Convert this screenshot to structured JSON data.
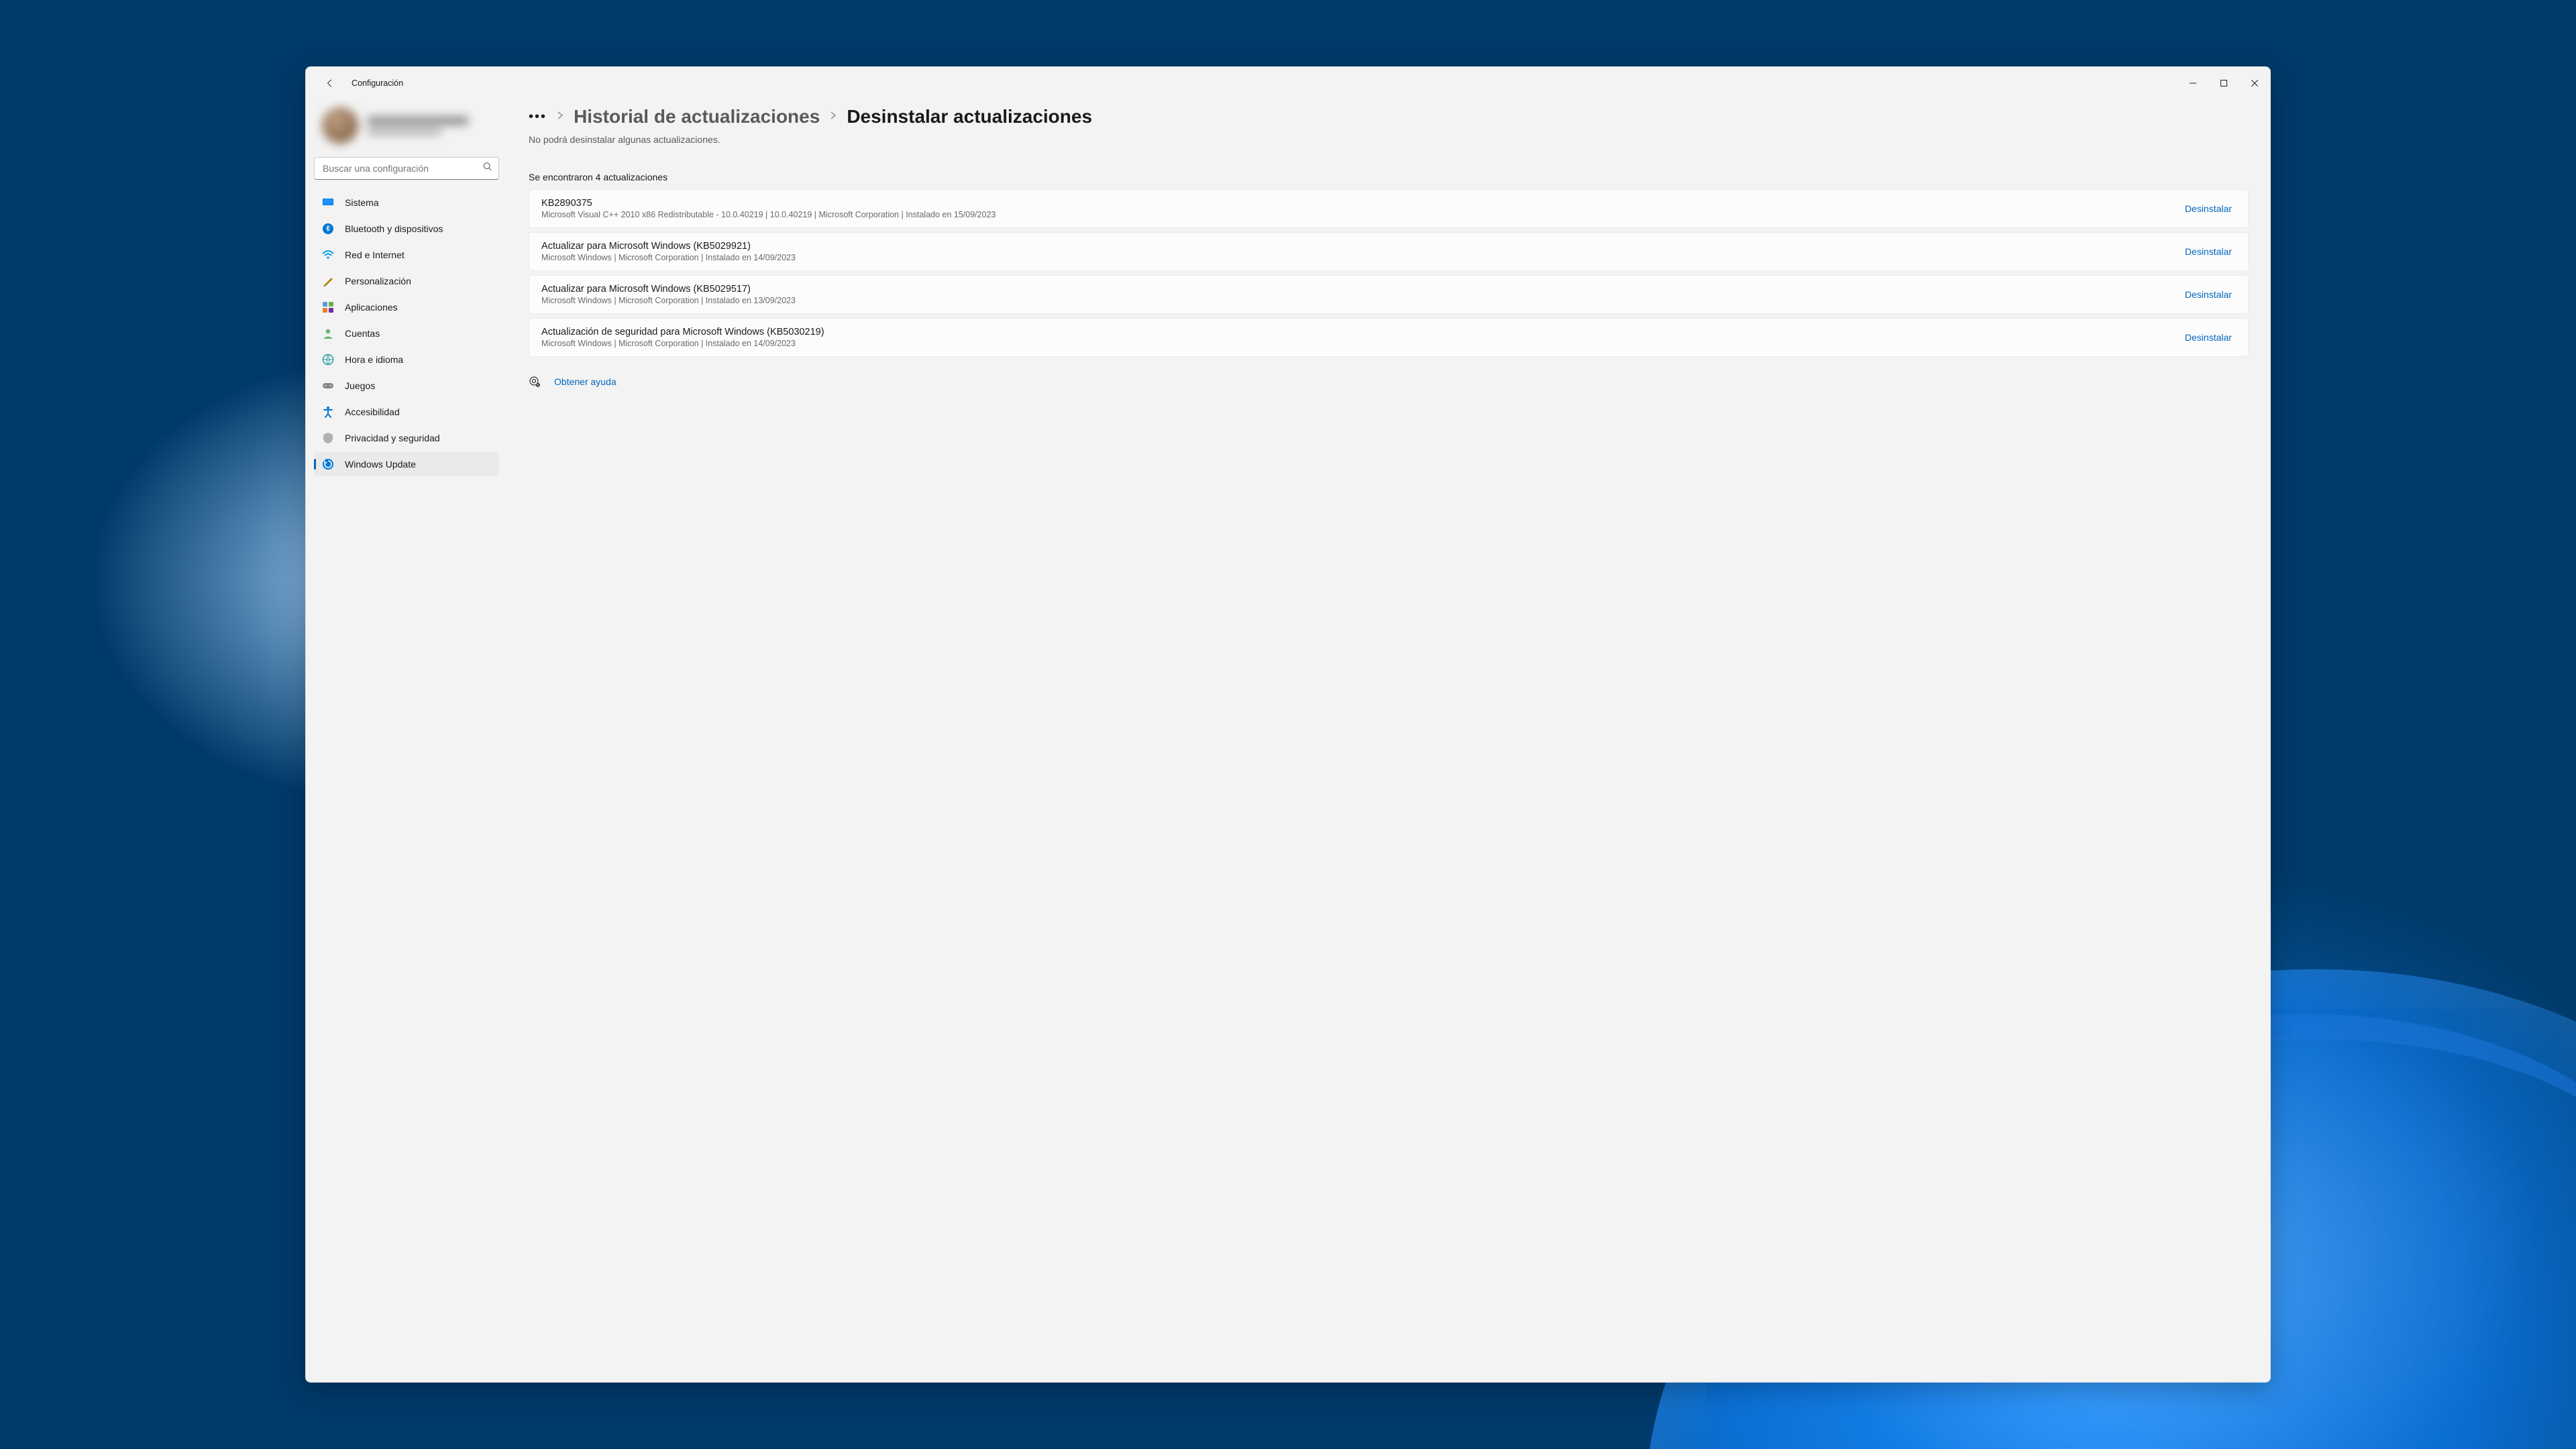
{
  "app_title": "Configuración",
  "search": {
    "placeholder": "Buscar una configuración"
  },
  "sidebar": {
    "items": [
      {
        "id": "system",
        "label": "Sistema"
      },
      {
        "id": "bluetooth",
        "label": "Bluetooth y dispositivos"
      },
      {
        "id": "network",
        "label": "Red e Internet"
      },
      {
        "id": "personalize",
        "label": "Personalización"
      },
      {
        "id": "apps",
        "label": "Aplicaciones"
      },
      {
        "id": "accounts",
        "label": "Cuentas"
      },
      {
        "id": "time",
        "label": "Hora e idioma"
      },
      {
        "id": "gaming",
        "label": "Juegos"
      },
      {
        "id": "accessibility",
        "label": "Accesibilidad"
      },
      {
        "id": "privacy",
        "label": "Privacidad y seguridad"
      },
      {
        "id": "update",
        "label": "Windows Update"
      }
    ]
  },
  "breadcrumb": {
    "prev": "Historial de actualizaciones",
    "current": "Desinstalar actualizaciones"
  },
  "subtext": "No podrá desinstalar algunas actualizaciones.",
  "count_text": "Se encontraron 4 actualizaciones",
  "uninstall_label": "Desinstalar",
  "updates": [
    {
      "title": "KB2890375",
      "meta": "Microsoft Visual C++ 2010  x86 Redistributable - 10.0.40219   |   10.0.40219   |   Microsoft Corporation   |   Instalado en 15/09/2023"
    },
    {
      "title": "Actualizar para Microsoft Windows (KB5029921)",
      "meta": "Microsoft Windows   |   Microsoft Corporation   |   Instalado en 14/09/2023"
    },
    {
      "title": "Actualizar para Microsoft Windows (KB5029517)",
      "meta": "Microsoft Windows   |   Microsoft Corporation   |   Instalado en 13/09/2023"
    },
    {
      "title": "Actualización de seguridad para Microsoft Windows (KB5030219)",
      "meta": "Microsoft Windows   |   Microsoft Corporation   |   Instalado en 14/09/2023"
    }
  ],
  "help_link": "Obtener ayuda"
}
